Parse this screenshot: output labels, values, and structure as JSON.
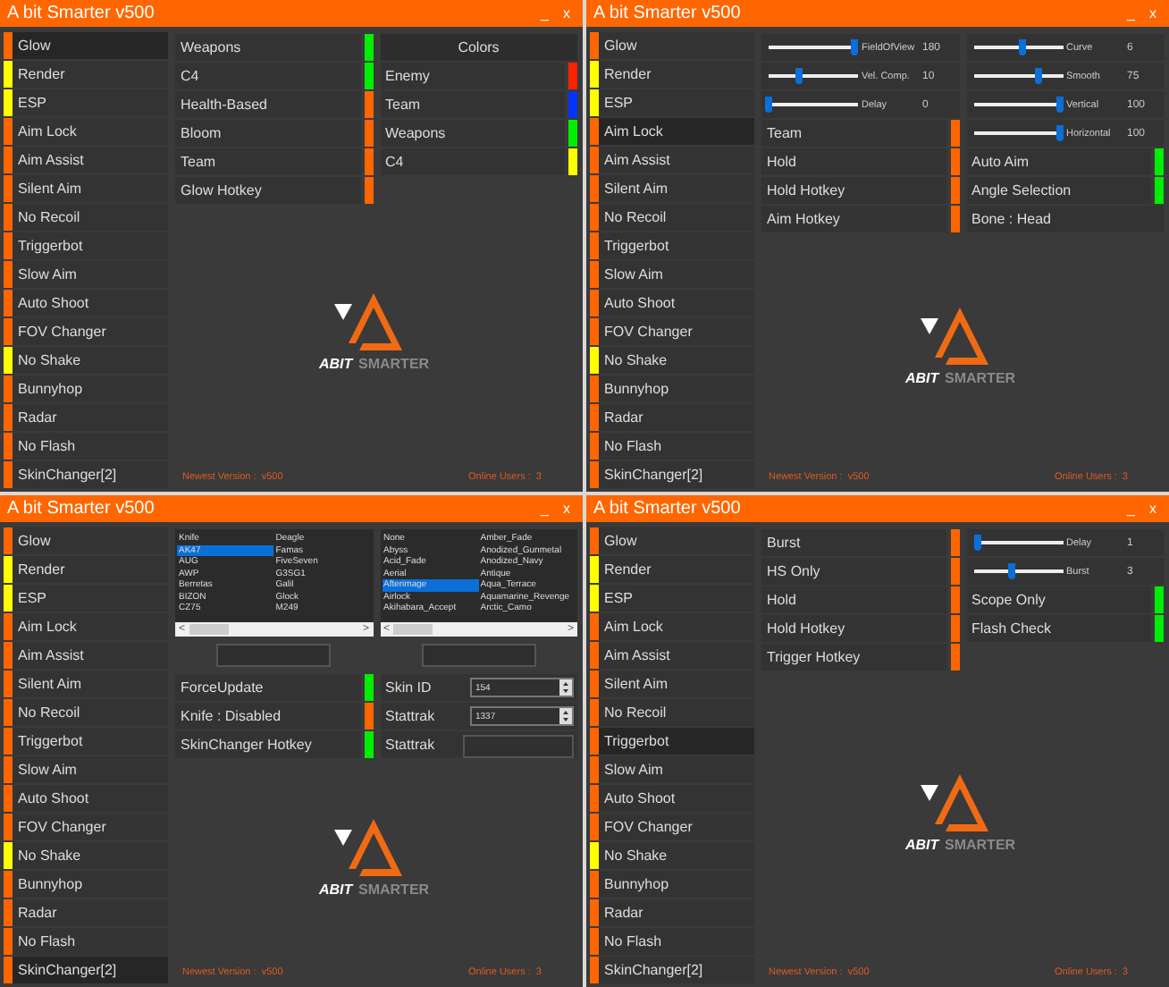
{
  "panels": [
    {
      "title": "A bit Smarter v500",
      "minimize": "_",
      "close": "x",
      "sidebar": [
        {
          "label": "Glow",
          "color": "#ff6600",
          "selected": true
        },
        {
          "label": "Render",
          "color": "#ffff00",
          "selected": false
        },
        {
          "label": "ESP",
          "color": "#ffff00",
          "selected": false
        },
        {
          "label": "Aim Lock",
          "color": "#ff6600",
          "selected": false
        },
        {
          "label": "Aim Assist",
          "color": "#ff6600",
          "selected": false
        },
        {
          "label": "Silent Aim",
          "color": "#ff6600",
          "selected": false
        },
        {
          "label": "No Recoil",
          "color": "#ff6600",
          "selected": false
        },
        {
          "label": "Triggerbot",
          "color": "#ff6600",
          "selected": false
        },
        {
          "label": "Slow Aim",
          "color": "#ff6600",
          "selected": false
        },
        {
          "label": "Auto Shoot",
          "color": "#ff6600",
          "selected": false
        },
        {
          "label": "FOV Changer",
          "color": "#ff6600",
          "selected": false
        },
        {
          "label": "No Shake",
          "color": "#ffff00",
          "selected": false
        },
        {
          "label": "Bunnyhop",
          "color": "#ff6600",
          "selected": false
        },
        {
          "label": "Radar",
          "color": "#ff6600",
          "selected": false
        },
        {
          "label": "No Flash",
          "color": "#ff6600",
          "selected": false
        },
        {
          "label": "SkinChanger[2]",
          "color": "#ff6600",
          "selected": false
        }
      ],
      "left": [
        {
          "kind": "toggle",
          "label": "Weapons",
          "color": "#00ee00"
        },
        {
          "kind": "toggle",
          "label": "C4",
          "color": "#00ee00"
        },
        {
          "kind": "toggle",
          "label": "Health-Based",
          "color": "#ff6600"
        },
        {
          "kind": "toggle",
          "label": "Bloom",
          "color": "#ff6600"
        },
        {
          "kind": "toggle",
          "label": "Team",
          "color": "#ff6600"
        },
        {
          "kind": "toggle",
          "label": "Glow Hotkey",
          "color": "#ff6600"
        }
      ],
      "right": [
        {
          "kind": "header",
          "label": "Colors"
        },
        {
          "kind": "toggle",
          "label": "Enemy",
          "color": "#ff2200"
        },
        {
          "kind": "toggle",
          "label": "Team",
          "color": "#0033ff"
        },
        {
          "kind": "toggle",
          "label": "Weapons",
          "color": "#00ee00"
        },
        {
          "kind": "toggle",
          "label": "C4",
          "color": "#ffff00"
        }
      ],
      "logo": {
        "mark": "ABIT",
        "sub": "SMARTER"
      },
      "footer": {
        "version": "Newest Version :  v500",
        "users": "Online Users :  3"
      }
    },
    {
      "title": "A bit Smarter v500",
      "minimize": "_",
      "close": "x",
      "sidebar": [
        {
          "label": "Glow",
          "color": "#ff6600",
          "selected": false
        },
        {
          "label": "Render",
          "color": "#ffff00",
          "selected": false
        },
        {
          "label": "ESP",
          "color": "#ffff00",
          "selected": false
        },
        {
          "label": "Aim Lock",
          "color": "#ff6600",
          "selected": true
        },
        {
          "label": "Aim Assist",
          "color": "#ff6600",
          "selected": false
        },
        {
          "label": "Silent Aim",
          "color": "#ff6600",
          "selected": false
        },
        {
          "label": "No Recoil",
          "color": "#ff6600",
          "selected": false
        },
        {
          "label": "Triggerbot",
          "color": "#ff6600",
          "selected": false
        },
        {
          "label": "Slow Aim",
          "color": "#ff6600",
          "selected": false
        },
        {
          "label": "Auto Shoot",
          "color": "#ff6600",
          "selected": false
        },
        {
          "label": "FOV Changer",
          "color": "#ff6600",
          "selected": false
        },
        {
          "label": "No Shake",
          "color": "#ffff00",
          "selected": false
        },
        {
          "label": "Bunnyhop",
          "color": "#ff6600",
          "selected": false
        },
        {
          "label": "Radar",
          "color": "#ff6600",
          "selected": false
        },
        {
          "label": "No Flash",
          "color": "#ff6600",
          "selected": false
        },
        {
          "label": "SkinChanger[2]",
          "color": "#ff6600",
          "selected": false
        }
      ],
      "left": [
        {
          "kind": "slider",
          "label": "FieldOfView",
          "value": "180",
          "level": 0.95
        },
        {
          "kind": "slider",
          "label": "Vel. Comp.",
          "value": "10",
          "level": 0.33
        },
        {
          "kind": "slider",
          "label": "Delay",
          "value": "0",
          "level": 0
        },
        {
          "kind": "toggle",
          "label": "Team",
          "color": "#ff6600"
        },
        {
          "kind": "toggle",
          "label": "Hold",
          "color": "#ff6600"
        },
        {
          "kind": "toggle",
          "label": "Hold Hotkey",
          "color": "#ff6600"
        },
        {
          "kind": "toggle",
          "label": "Aim Hotkey",
          "color": "#ff6600"
        }
      ],
      "right": [
        {
          "kind": "slider",
          "label": "Curve",
          "value": "6",
          "level": 0.55
        },
        {
          "kind": "slider",
          "label": "Smooth",
          "value": "75",
          "level": 0.73
        },
        {
          "kind": "slider",
          "label": "Vertical",
          "value": "100",
          "level": 0.96
        },
        {
          "kind": "slider",
          "label": "Horizontal",
          "value": "100",
          "level": 0.96
        },
        {
          "kind": "toggle",
          "label": "Auto Aim",
          "color": "#00ee00"
        },
        {
          "kind": "toggle",
          "label": "Angle Selection",
          "color": "#00ee00"
        },
        {
          "kind": "text",
          "label": "Bone : Head"
        }
      ],
      "logo": {
        "mark": "ABIT",
        "sub": "SMARTER"
      },
      "footer": {
        "version": "Newest Version :  v500",
        "users": "Online Users :  3"
      }
    },
    {
      "title": "A bit Smarter v500",
      "minimize": "_",
      "close": "x",
      "sidebar": [
        {
          "label": "Glow",
          "color": "#ff6600",
          "selected": false
        },
        {
          "label": "Render",
          "color": "#ffff00",
          "selected": false
        },
        {
          "label": "ESP",
          "color": "#ffff00",
          "selected": false
        },
        {
          "label": "Aim Lock",
          "color": "#ff6600",
          "selected": false
        },
        {
          "label": "Aim Assist",
          "color": "#ff6600",
          "selected": false
        },
        {
          "label": "Silent Aim",
          "color": "#ff6600",
          "selected": false
        },
        {
          "label": "No Recoil",
          "color": "#ff6600",
          "selected": false
        },
        {
          "label": "Triggerbot",
          "color": "#ff6600",
          "selected": false
        },
        {
          "label": "Slow Aim",
          "color": "#ff6600",
          "selected": false
        },
        {
          "label": "Auto Shoot",
          "color": "#ff6600",
          "selected": false
        },
        {
          "label": "FOV Changer",
          "color": "#ff6600",
          "selected": false
        },
        {
          "label": "No Shake",
          "color": "#ffff00",
          "selected": false
        },
        {
          "label": "Bunnyhop",
          "color": "#ff6600",
          "selected": false
        },
        {
          "label": "Radar",
          "color": "#ff6600",
          "selected": false
        },
        {
          "label": "No Flash",
          "color": "#ff6600",
          "selected": false
        },
        {
          "label": "SkinChanger[2]",
          "color": "#ff6600",
          "selected": true
        }
      ],
      "left": [
        {
          "kind": "listbox",
          "columns": [
            [
              {
                "label": "Knife",
                "selected": false
              },
              {
                "label": "AK47",
                "selected": true
              },
              {
                "label": "AUG",
                "selected": false
              },
              {
                "label": "AWP",
                "selected": false
              },
              {
                "label": "Berretas",
                "selected": false
              },
              {
                "label": "BIZON",
                "selected": false
              },
              {
                "label": "CZ75",
                "selected": false
              }
            ],
            [
              {
                "label": "Deagle",
                "selected": false
              },
              {
                "label": "Famas",
                "selected": false
              },
              {
                "label": "FiveSeven",
                "selected": false
              },
              {
                "label": "G3SG1",
                "selected": false
              },
              {
                "label": "Galil",
                "selected": false
              },
              {
                "label": "Glock",
                "selected": false
              },
              {
                "label": "M249",
                "selected": false
              }
            ]
          ],
          "scroll_left": "<",
          "scroll_right": ">"
        },
        {
          "kind": "toggle",
          "label": "ForceUpdate",
          "color": "#00ee00"
        },
        {
          "kind": "toggle",
          "label": "Knife : Disabled",
          "color": "#ff6600"
        },
        {
          "kind": "toggle",
          "label": "SkinChanger Hotkey",
          "color": "#00ee00"
        }
      ],
      "right": [
        {
          "kind": "listbox",
          "columns": [
            [
              {
                "label": "None",
                "selected": false
              },
              {
                "label": "Abyss",
                "selected": false
              },
              {
                "label": "Acid_Fade",
                "selected": false
              },
              {
                "label": "Aerial",
                "selected": false
              },
              {
                "label": "Afterimage",
                "selected": true
              },
              {
                "label": "Airlock",
                "selected": false
              },
              {
                "label": "Akihabara_Accept",
                "selected": false
              }
            ],
            [
              {
                "label": "Amber_Fade",
                "selected": false
              },
              {
                "label": "Anodized_Gunmetal",
                "selected": false
              },
              {
                "label": "Anodized_Navy",
                "selected": false
              },
              {
                "label": "Antique",
                "selected": false
              },
              {
                "label": "Aqua_Terrace",
                "selected": false
              },
              {
                "label": "Aquamarine_Revenge",
                "selected": false
              },
              {
                "label": "Arctic_Camo",
                "selected": false
              }
            ]
          ],
          "scroll_left": "<",
          "scroll_right": ">"
        },
        {
          "kind": "spin",
          "label": "Skin ID",
          "value": "154"
        },
        {
          "kind": "spin",
          "label": "Stattrak",
          "value": "1337"
        },
        {
          "kind": "input",
          "label": "Stattrak"
        }
      ],
      "logo": {
        "mark": "ABIT",
        "sub": "SMARTER"
      },
      "footer": {
        "version": "Newest Version :  v500",
        "users": "Online Users :  3"
      }
    },
    {
      "title": "A bit Smarter v500",
      "minimize": "_",
      "close": "x",
      "sidebar": [
        {
          "label": "Glow",
          "color": "#ff6600",
          "selected": false
        },
        {
          "label": "Render",
          "color": "#ffff00",
          "selected": false
        },
        {
          "label": "ESP",
          "color": "#ffff00",
          "selected": false
        },
        {
          "label": "Aim Lock",
          "color": "#ff6600",
          "selected": false
        },
        {
          "label": "Aim Assist",
          "color": "#ff6600",
          "selected": false
        },
        {
          "label": "Silent Aim",
          "color": "#ff6600",
          "selected": false
        },
        {
          "label": "No Recoil",
          "color": "#ff6600",
          "selected": false
        },
        {
          "label": "Triggerbot",
          "color": "#ff6600",
          "selected": true
        },
        {
          "label": "Slow Aim",
          "color": "#ff6600",
          "selected": false
        },
        {
          "label": "Auto Shoot",
          "color": "#ff6600",
          "selected": false
        },
        {
          "label": "FOV Changer",
          "color": "#ff6600",
          "selected": false
        },
        {
          "label": "No Shake",
          "color": "#ffff00",
          "selected": false
        },
        {
          "label": "Bunnyhop",
          "color": "#ff6600",
          "selected": false
        },
        {
          "label": "Radar",
          "color": "#ff6600",
          "selected": false
        },
        {
          "label": "No Flash",
          "color": "#ff6600",
          "selected": false
        },
        {
          "label": "SkinChanger[2]",
          "color": "#ff6600",
          "selected": false
        }
      ],
      "left": [
        {
          "kind": "toggle",
          "label": "Burst",
          "color": "#ff6600"
        },
        {
          "kind": "toggle",
          "label": "HS Only",
          "color": "#ff6600"
        },
        {
          "kind": "toggle",
          "label": "Hold",
          "color": "#ff6600"
        },
        {
          "kind": "toggle",
          "label": "Hold Hotkey",
          "color": "#ff6600"
        },
        {
          "kind": "toggle",
          "label": "Trigger Hotkey",
          "color": "#ff6600"
        }
      ],
      "right": [
        {
          "kind": "slider",
          "label": "Delay",
          "value": "1",
          "level": 0.05
        },
        {
          "kind": "slider",
          "label": "Burst",
          "value": "3",
          "level": 0.43
        },
        {
          "kind": "toggle",
          "label": "Scope Only",
          "color": "#00ee00"
        },
        {
          "kind": "toggle",
          "label": "Flash Check",
          "color": "#00ee00"
        }
      ],
      "logo": {
        "mark": "ABIT",
        "sub": "SMARTER"
      },
      "footer": {
        "version": "Newest Version :  v500",
        "users": "Online Users :  3"
      }
    }
  ]
}
